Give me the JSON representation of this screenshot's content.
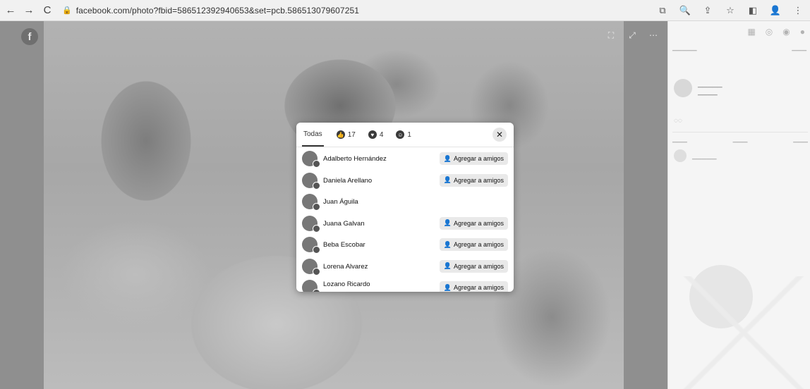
{
  "browser": {
    "url": "facebook.com/photo?fbid=586512392940653&set=pcb.586513079607251",
    "back_glyph": "←",
    "forward_glyph": "→",
    "reload_glyph": "C",
    "lock_glyph": "🔒",
    "actions": [
      {
        "name": "install-icon",
        "glyph": "⧉"
      },
      {
        "name": "zoom-icon",
        "glyph": "🔍"
      },
      {
        "name": "share-icon",
        "glyph": "⇪"
      },
      {
        "name": "bookmark-star-icon",
        "glyph": "☆"
      },
      {
        "name": "sidepanel-icon",
        "glyph": "◧"
      },
      {
        "name": "profile-icon",
        "glyph": "👤"
      },
      {
        "name": "menu-icon",
        "glyph": "⋮"
      }
    ]
  },
  "photo": {
    "logo_glyph": "f",
    "tools": [
      "⛶",
      "⤢",
      "⋯"
    ]
  },
  "modal": {
    "tabs": [
      {
        "label": "Todas",
        "active": true
      },
      {
        "label": "17",
        "icon": "like-icon",
        "glyph": "👍",
        "active": false
      },
      {
        "label": "4",
        "icon": "love-icon",
        "glyph": "♥",
        "active": false
      },
      {
        "label": "1",
        "icon": "care-icon",
        "glyph": "☺",
        "active": false
      }
    ],
    "close_glyph": "✕",
    "add_label": "Agregar a amigos",
    "rows": [
      {
        "name": "Adalberto Hernández",
        "button": true
      },
      {
        "name": "Daniela Arellano",
        "button": true
      },
      {
        "name": "Juan Águila",
        "button": false
      },
      {
        "name": "Juana Galvan",
        "button": true
      },
      {
        "name": "Beba Escobar",
        "button": true
      },
      {
        "name": "Lorena Alvarez",
        "button": true
      },
      {
        "name": "Lozano Ricardo",
        "button": true
      }
    ]
  }
}
